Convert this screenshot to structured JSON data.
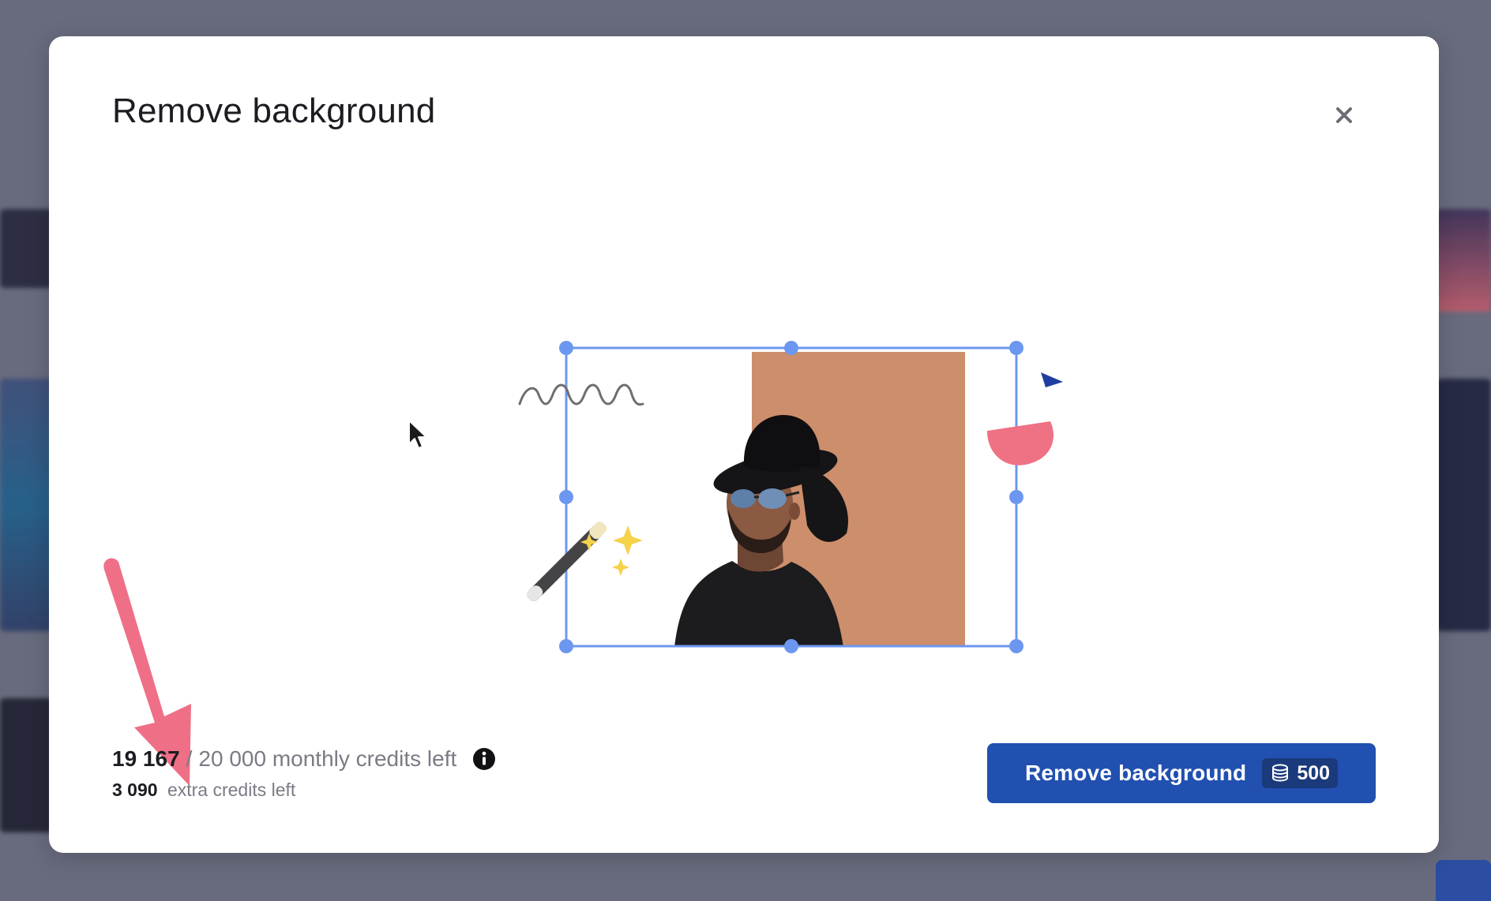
{
  "dialog": {
    "title": "Remove background",
    "close_icon": "close-icon"
  },
  "credits": {
    "monthly_used": "19 167",
    "separator": "/",
    "monthly_total_text": "20 000 monthly credits left",
    "info_icon": "info-icon",
    "extra_count": "3 090",
    "extra_text": "extra credits left"
  },
  "action": {
    "label": "Remove background",
    "cost": "500",
    "cost_icon": "coins-stack-icon",
    "color": "#2150b0"
  },
  "colors": {
    "overlay": "#686b7d",
    "selection": "#6c97f0",
    "annotation_arrow": "#ef6f86"
  }
}
